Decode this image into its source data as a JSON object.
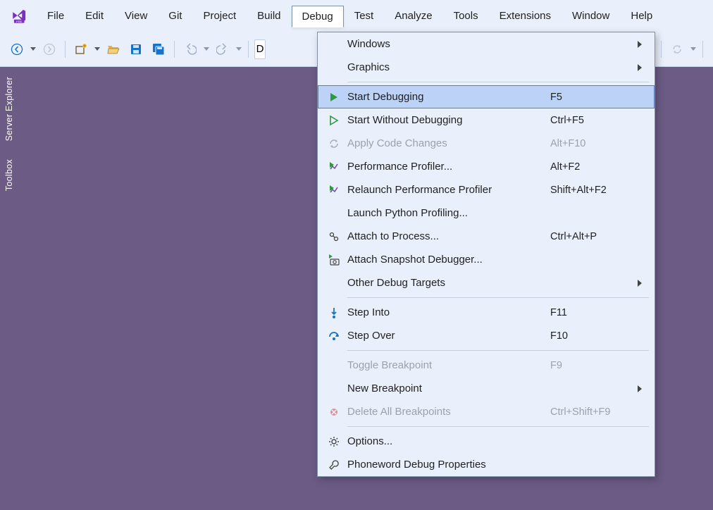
{
  "menubar": {
    "items": [
      "File",
      "Edit",
      "View",
      "Git",
      "Project",
      "Build",
      "Debug",
      "Test",
      "Analyze",
      "Tools",
      "Extensions",
      "Window",
      "Help"
    ],
    "openIndex": 6
  },
  "toolbar": {
    "combo_letter": "D"
  },
  "sidebar": {
    "tabs": [
      "Server Explorer",
      "Toolbox"
    ]
  },
  "dropdown": {
    "groups": [
      [
        {
          "icon": "",
          "label": "Windows",
          "accel": "",
          "sub": true,
          "disabled": false
        },
        {
          "icon": "",
          "label": "Graphics",
          "accel": "",
          "sub": true,
          "disabled": false
        }
      ],
      [
        {
          "icon": "play-solid",
          "label": "Start Debugging",
          "accel": "F5",
          "sub": false,
          "disabled": false,
          "highlight": true
        },
        {
          "icon": "play-outline",
          "label": "Start Without Debugging",
          "accel": "Ctrl+F5",
          "sub": false,
          "disabled": false
        },
        {
          "icon": "cycle",
          "label": "Apply Code Changes",
          "accel": "Alt+F10",
          "sub": false,
          "disabled": true
        },
        {
          "icon": "profiler",
          "label": "Performance Profiler...",
          "accel": "Alt+F2",
          "sub": false,
          "disabled": false
        },
        {
          "icon": "profiler",
          "label": "Relaunch Performance Profiler",
          "accel": "Shift+Alt+F2",
          "sub": false,
          "disabled": false
        },
        {
          "icon": "",
          "label": "Launch Python Profiling...",
          "accel": "",
          "sub": false,
          "disabled": false
        },
        {
          "icon": "attach",
          "label": "Attach to Process...",
          "accel": "Ctrl+Alt+P",
          "sub": false,
          "disabled": false
        },
        {
          "icon": "snapshot",
          "label": "Attach Snapshot Debugger...",
          "accel": "",
          "sub": false,
          "disabled": false
        },
        {
          "icon": "",
          "label": "Other Debug Targets",
          "accel": "",
          "sub": true,
          "disabled": false
        }
      ],
      [
        {
          "icon": "step-into",
          "label": "Step Into",
          "accel": "F11",
          "sub": false,
          "disabled": false
        },
        {
          "icon": "step-over",
          "label": "Step Over",
          "accel": "F10",
          "sub": false,
          "disabled": false
        }
      ],
      [
        {
          "icon": "",
          "label": "Toggle Breakpoint",
          "accel": "F9",
          "sub": false,
          "disabled": true
        },
        {
          "icon": "",
          "label": "New Breakpoint",
          "accel": "",
          "sub": true,
          "disabled": false
        },
        {
          "icon": "bp-delete",
          "label": "Delete All Breakpoints",
          "accel": "Ctrl+Shift+F9",
          "sub": false,
          "disabled": true
        }
      ],
      [
        {
          "icon": "gear",
          "label": "Options...",
          "accel": "",
          "sub": false,
          "disabled": false
        },
        {
          "icon": "wrench",
          "label": "Phoneword Debug Properties",
          "accel": "",
          "sub": false,
          "disabled": false
        }
      ]
    ]
  }
}
